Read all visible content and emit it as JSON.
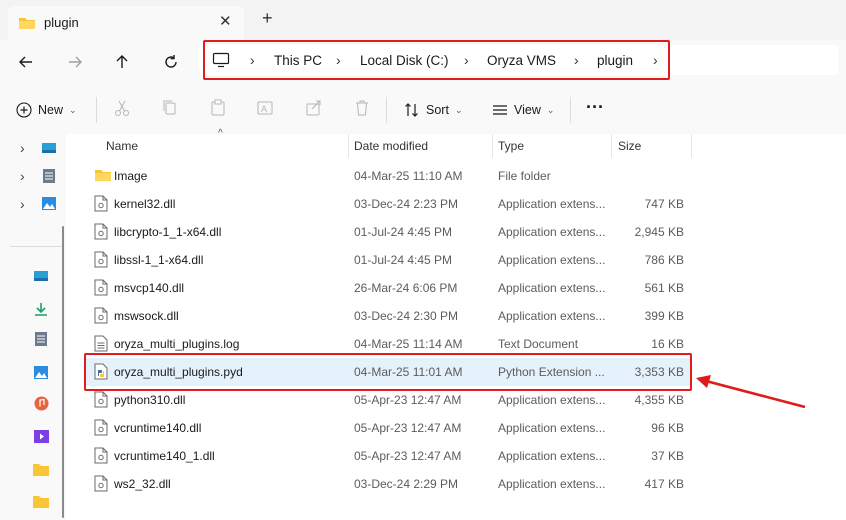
{
  "window": {
    "tab_title": "plugin",
    "new_tab_symbol": "+"
  },
  "address": {
    "crumbs": [
      "This PC",
      "Local Disk (C:)",
      "Oryza VMS",
      "plugin"
    ]
  },
  "toolbar": {
    "new_label": "New",
    "sort_label": "Sort",
    "view_label": "View",
    "more_label": "···"
  },
  "columns": {
    "name": "Name",
    "date": "Date modified",
    "type": "Type",
    "size": "Size"
  },
  "files": [
    {
      "name": "Image",
      "date": "04-Mar-25 11:10 AM",
      "type": "File folder",
      "size": "",
      "icon": "folder-icon"
    },
    {
      "name": "kernel32.dll",
      "date": "03-Dec-24 2:23 PM",
      "type": "Application extens...",
      "size": "747 KB",
      "icon": "dll-file-icon"
    },
    {
      "name": "libcrypto-1_1-x64.dll",
      "date": "01-Jul-24 4:45 PM",
      "type": "Application extens...",
      "size": "2,945 KB",
      "icon": "dll-file-icon"
    },
    {
      "name": "libssl-1_1-x64.dll",
      "date": "01-Jul-24 4:45 PM",
      "type": "Application extens...",
      "size": "786 KB",
      "icon": "dll-file-icon"
    },
    {
      "name": "msvcp140.dll",
      "date": "26-Mar-24 6:06 PM",
      "type": "Application extens...",
      "size": "561 KB",
      "icon": "dll-file-icon"
    },
    {
      "name": "mswsock.dll",
      "date": "03-Dec-24 2:30 PM",
      "type": "Application extens...",
      "size": "399 KB",
      "icon": "dll-file-icon"
    },
    {
      "name": "oryza_multi_plugins.log",
      "date": "04-Mar-25 11:14 AM",
      "type": "Text Document",
      "size": "16 KB",
      "icon": "text-file-icon"
    },
    {
      "name": "oryza_multi_plugins.pyd",
      "date": "04-Mar-25 11:01 AM",
      "type": "Python Extension ...",
      "size": "3,353 KB",
      "icon": "python-file-icon"
    },
    {
      "name": "python310.dll",
      "date": "05-Apr-23 12:47 AM",
      "type": "Application extens...",
      "size": "4,355 KB",
      "icon": "dll-file-icon"
    },
    {
      "name": "vcruntime140.dll",
      "date": "05-Apr-23 12:47 AM",
      "type": "Application extens...",
      "size": "96 KB",
      "icon": "dll-file-icon"
    },
    {
      "name": "vcruntime140_1.dll",
      "date": "05-Apr-23 12:47 AM",
      "type": "Application extens...",
      "size": "37 KB",
      "icon": "dll-file-icon"
    },
    {
      "name": "ws2_32.dll",
      "date": "03-Dec-24 2:29 PM",
      "type": "Application extens...",
      "size": "417 KB",
      "icon": "dll-file-icon"
    }
  ],
  "selected_file": "oryza_multi_plugins.pyd",
  "colors": {
    "highlight": "#e01b1b",
    "selection": "#e5f1fb",
    "folder": "#f8c537",
    "accent": "#0067c0"
  }
}
